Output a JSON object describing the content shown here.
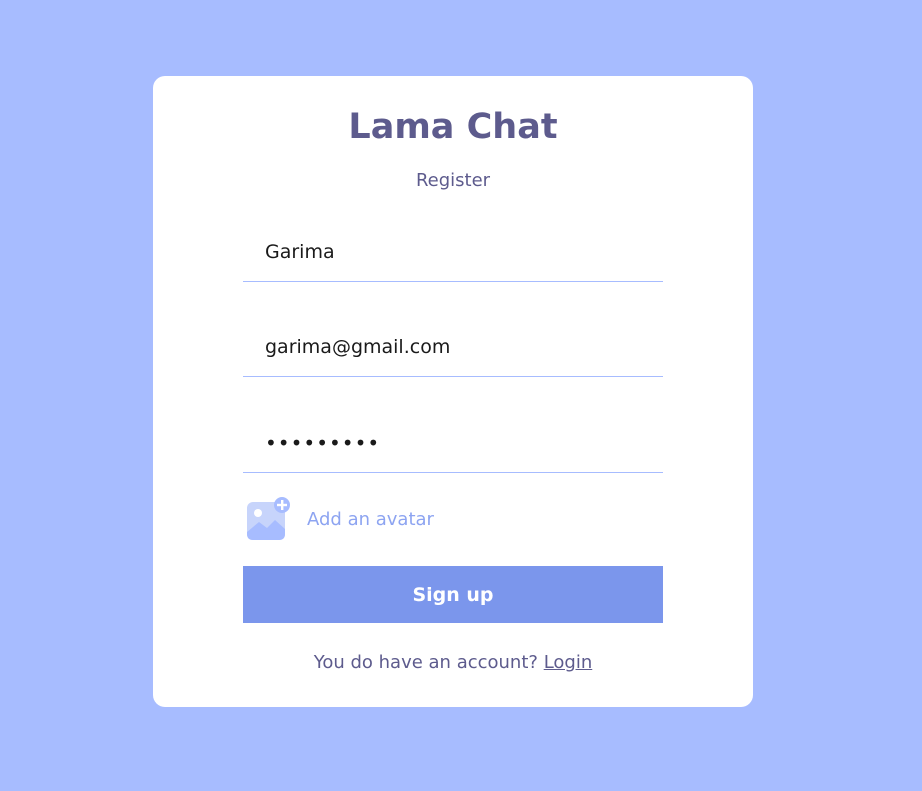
{
  "logo": "Lama Chat",
  "subtitle": "Register",
  "form": {
    "name_value": "Garima",
    "email_value": "garima@gmail.com",
    "password_value": "•••••••••",
    "avatar_label": "Add an avatar",
    "avatar_icon": "add-image-icon",
    "submit_label": "Sign up"
  },
  "footer": {
    "prompt": "You do have an account? ",
    "link_label": "Login"
  },
  "colors": {
    "background": "#a7bcff",
    "card": "#ffffff",
    "brand_text": "#5d5b8d",
    "button": "#7b96ec",
    "avatar_label": "#8da4f1",
    "underline": "#a7bcff"
  }
}
